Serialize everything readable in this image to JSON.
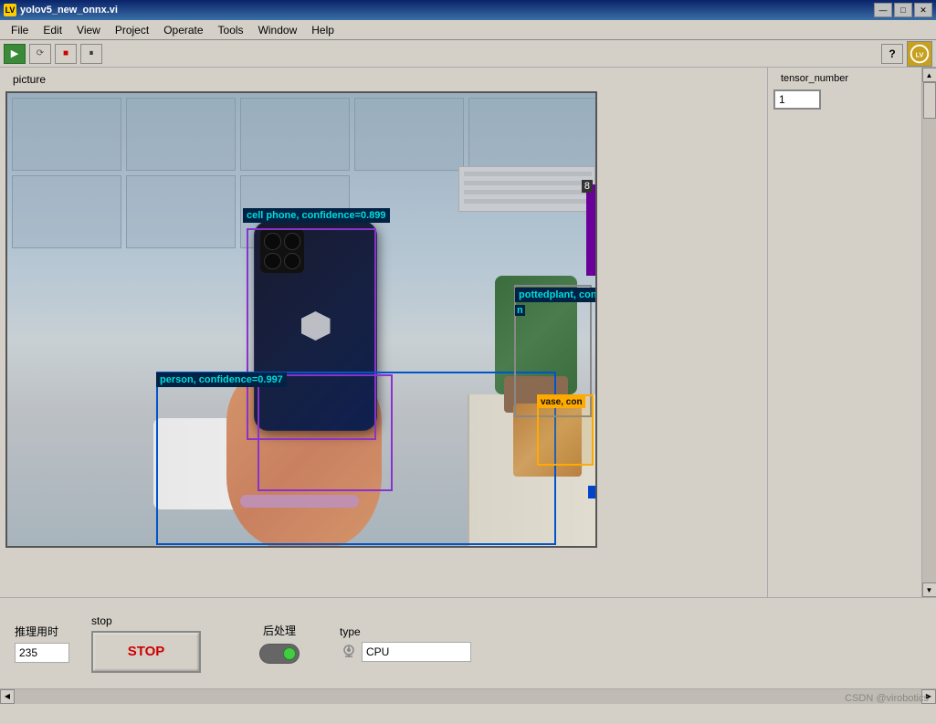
{
  "window": {
    "title": "yolov5_new_onnx.vi",
    "controls": {
      "minimize": "—",
      "maximize": "□",
      "close": "✕"
    }
  },
  "menu": {
    "items": [
      "File",
      "Edit",
      "View",
      "Project",
      "Operate",
      "Tools",
      "Window",
      "Help"
    ]
  },
  "toolbar": {
    "run_label": "▶",
    "runonce_label": "↻",
    "abort_label": "■",
    "pause_label": "⏸",
    "help_label": "?"
  },
  "panel": {
    "picture_label": "picture",
    "tensor_label": "tensor_number",
    "tensor_value": "1"
  },
  "detections": {
    "cellphone": "cell phone, confidence=0.899",
    "person": "person, confidence=0.997",
    "plant": "pottedplant, confi",
    "vase": "vase, con"
  },
  "controls": {
    "inference_label": "推理用时",
    "inference_value": "235",
    "stop_label": "stop",
    "stop_button": "STOP",
    "postprocess_label": "后处理",
    "type_label": "type",
    "type_value": "CPU"
  },
  "statusbar": {
    "watermark": "CSDN @virobotics"
  }
}
